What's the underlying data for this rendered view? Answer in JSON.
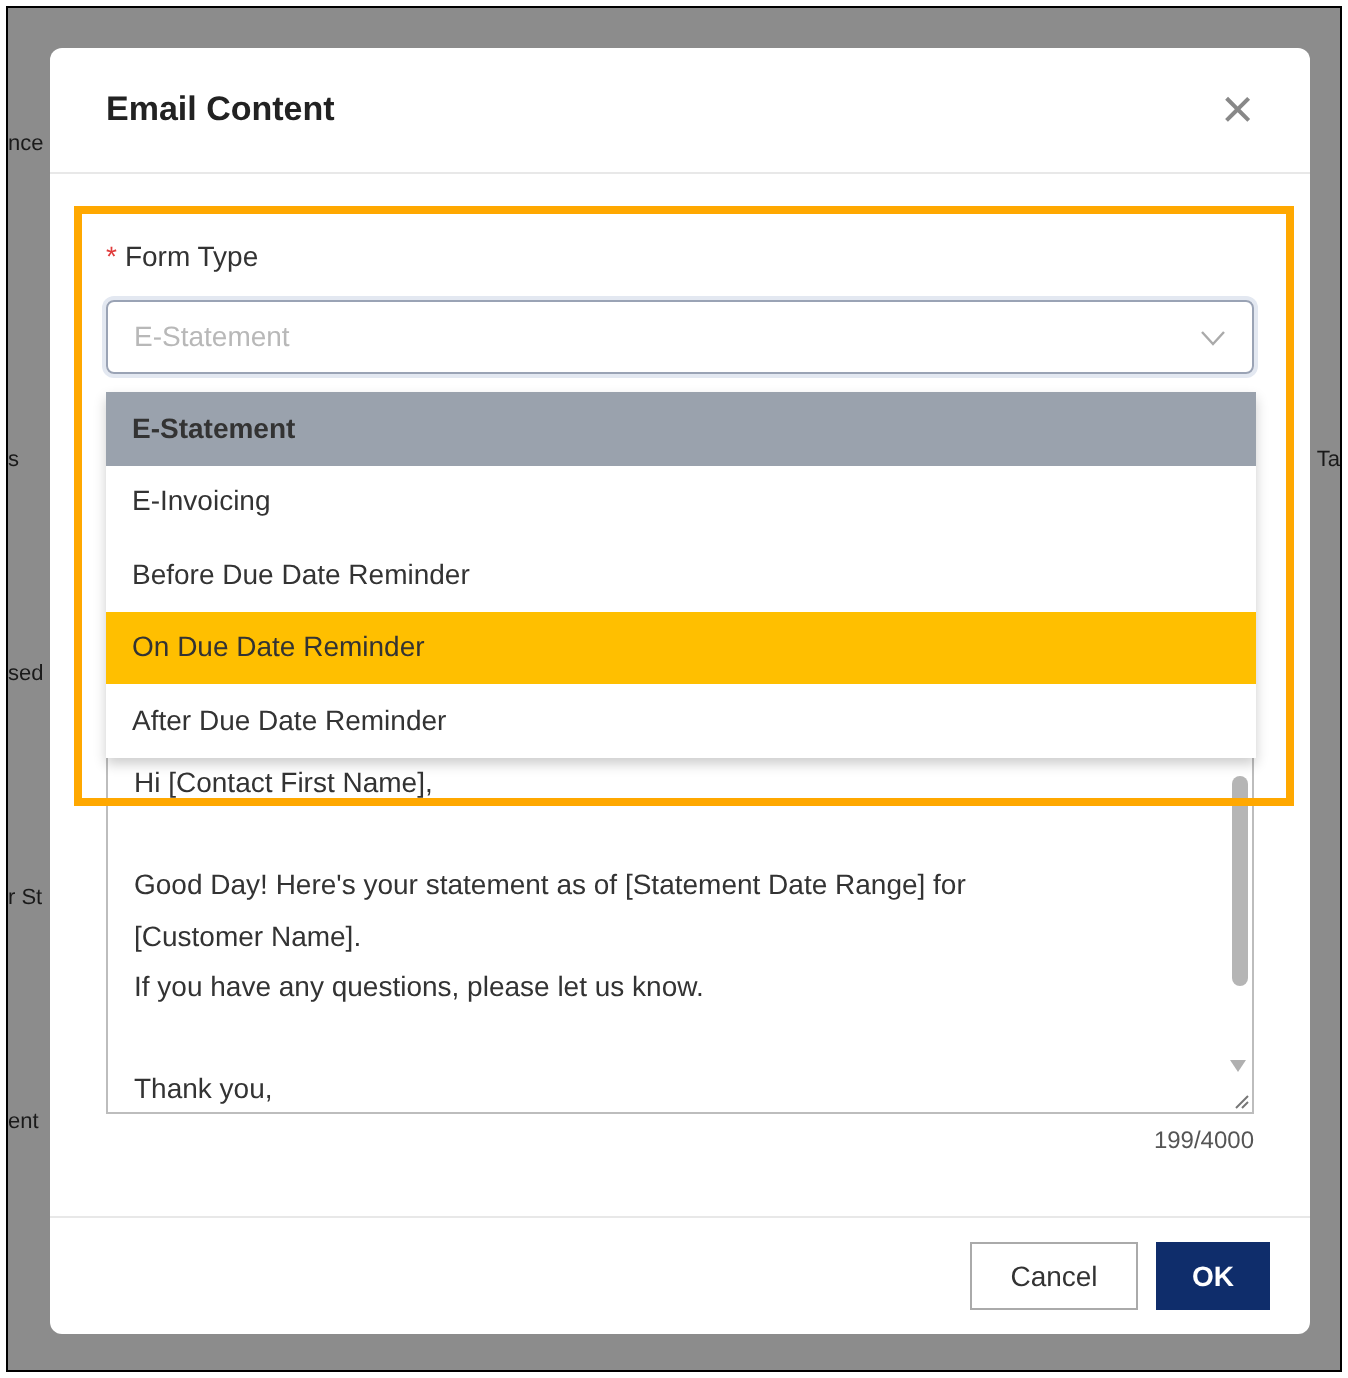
{
  "background_page": {
    "fragments": [
      "nce",
      "s",
      "Ta",
      "sed",
      "r St",
      "ent"
    ]
  },
  "dialog": {
    "title": "Email Content",
    "close": "×",
    "form_type": {
      "required_mark": "*",
      "label": "Form Type",
      "placeholder": "E-Statement",
      "expanded": true,
      "options": [
        {
          "label": "E-Statement",
          "selected": true,
          "highlighted": false
        },
        {
          "label": "E-Invoicing",
          "selected": false,
          "highlighted": false
        },
        {
          "label": "Before Due Date Reminder",
          "selected": false,
          "highlighted": false
        },
        {
          "label": "On Due Date Reminder",
          "selected": false,
          "highlighted": true
        },
        {
          "label": "After Due Date Reminder",
          "selected": false,
          "highlighted": false
        }
      ]
    },
    "message": {
      "value": "Hi [Contact First Name],\n\nGood Day! Here's your statement as of [Statement Date Range] for [Customer Name].\nIf you have any questions, please let us know.\n\nThank you,",
      "counter": "199/4000"
    },
    "buttons": [
      {
        "label": "Cancel",
        "kind": "secondary"
      },
      {
        "label": "OK",
        "kind": "primary"
      }
    ]
  }
}
